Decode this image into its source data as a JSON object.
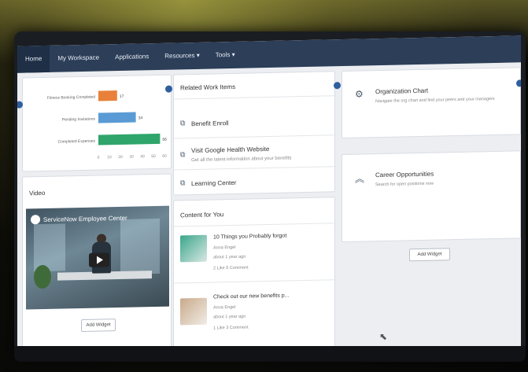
{
  "nav": {
    "items": [
      {
        "label": "Home"
      },
      {
        "label": "My Workspace"
      },
      {
        "label": "Applications"
      },
      {
        "label": "Resources ▾"
      },
      {
        "label": "Tools ▾"
      }
    ]
  },
  "chart": {
    "categories": [
      {
        "label": "Fitness Booking Completed"
      },
      {
        "label": "Pending Invitations"
      },
      {
        "label": "Completed Expenses"
      }
    ],
    "values": [
      17,
      34,
      56
    ],
    "colors": [
      "#e9803a",
      "#5b9bd5",
      "#2fa56b"
    ],
    "value_labels": [
      "17",
      "34",
      "56"
    ],
    "ticks": [
      "0",
      "10",
      "20",
      "30",
      "40",
      "50",
      "60"
    ]
  },
  "video_card": {
    "title": "Video",
    "video_overlay": "ServiceNow Employee Center",
    "add_widget": "Add Widget"
  },
  "related_links": {
    "title": "Related Work Items",
    "items": [
      {
        "label": "Benefit Enroll"
      },
      {
        "label": "Visit Google Health Website",
        "sub": "Get all the latest information about your benefits"
      },
      {
        "label": "Learning Center"
      }
    ]
  },
  "content_card": {
    "title": "Content for You",
    "items": [
      {
        "title": "10 Things you Probably forgot",
        "author": "Anna Engel",
        "time": "about 1 year ago",
        "likes": "2 Like 5 Comment"
      },
      {
        "title": "Check out our new benefits p...",
        "author": "Anna Engel",
        "time": "about 1 year ago",
        "likes": "1 Like 3 Comment"
      }
    ]
  },
  "org_chart": {
    "title": "Organization Chart",
    "sub": "Navigate the org chart and find your peers and your managers"
  },
  "career": {
    "title": "Career Opportunities",
    "sub": "Search for open positions now"
  },
  "add_widget_right": "Add Widget",
  "add_widget_left": "Add Widget",
  "icons": {
    "org": "org-chart-icon",
    "career": "chevrons-up-icon",
    "link": "external-link-icon",
    "cursor": "mouse-cursor-icon"
  }
}
